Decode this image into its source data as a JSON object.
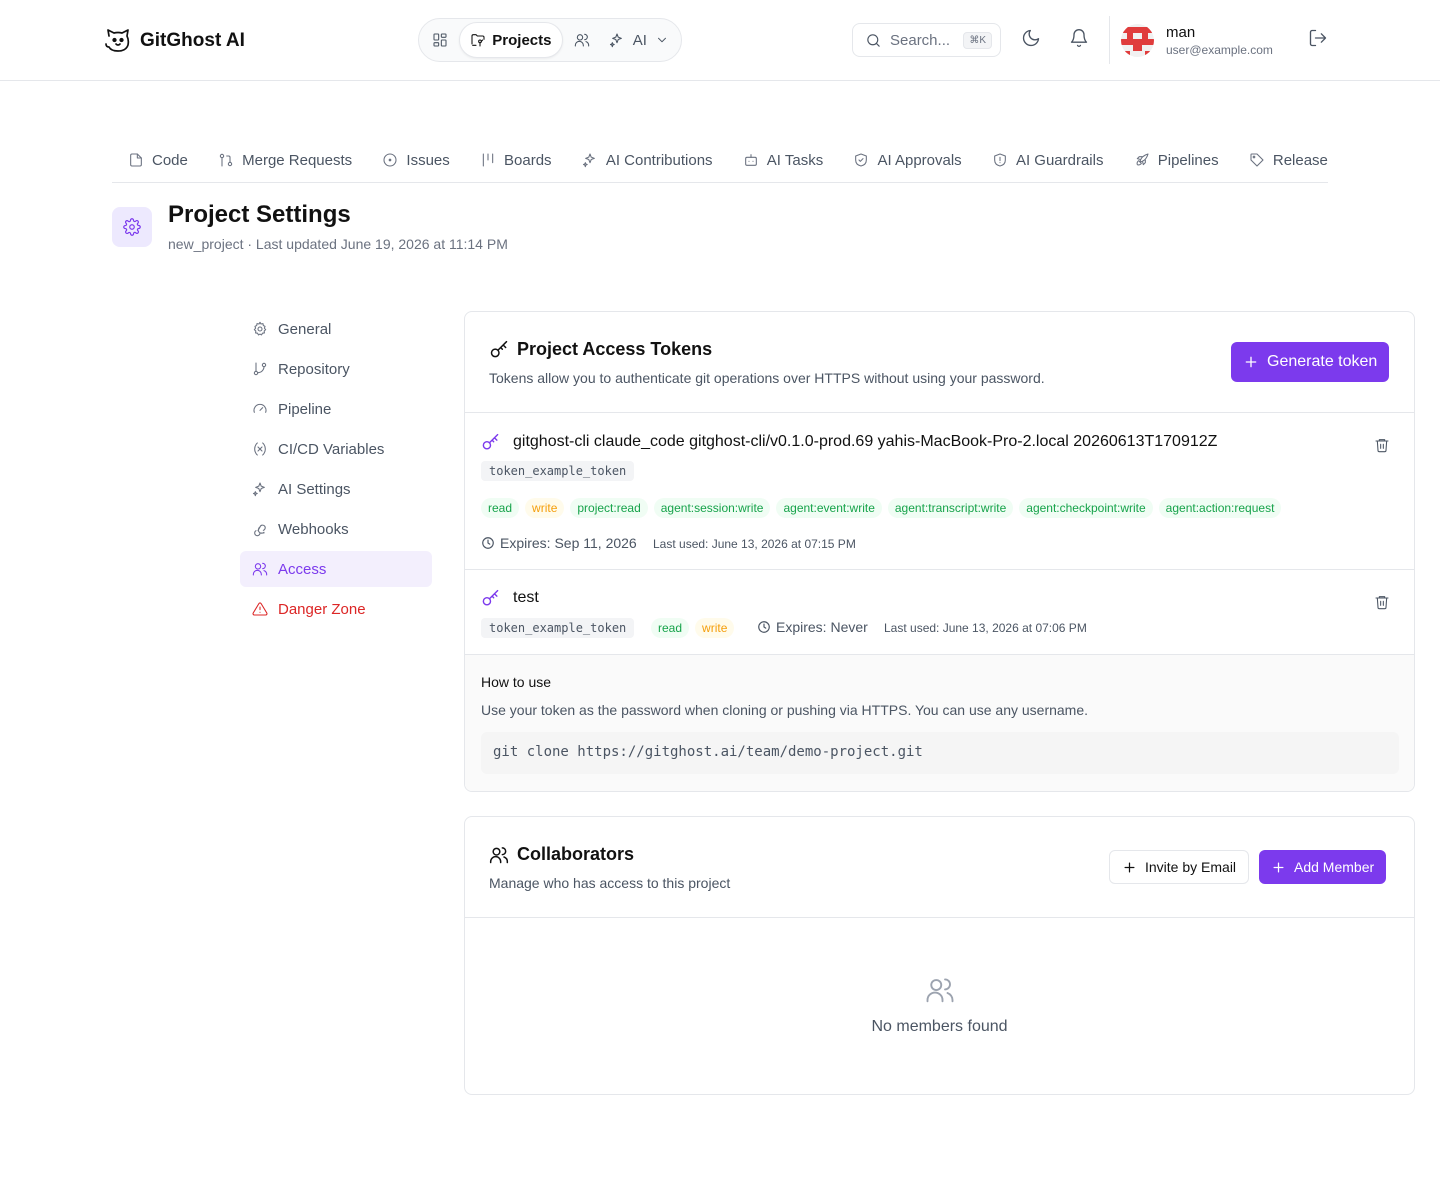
{
  "app": {
    "name": "GitGhost AI"
  },
  "topnav": {
    "projects_label": "Projects",
    "ai_label": "AI"
  },
  "search": {
    "placeholder": "Search...",
    "shortcut": "⌘K"
  },
  "user": {
    "name": "man",
    "email": "user@example.com"
  },
  "project_tabs": [
    {
      "label": "Code",
      "icon": "file-icon"
    },
    {
      "label": "Merge Requests",
      "icon": "git-pull-request-icon"
    },
    {
      "label": "Issues",
      "icon": "circle-dot-icon"
    },
    {
      "label": "Boards",
      "icon": "kanban-icon"
    },
    {
      "label": "AI Contributions",
      "icon": "sparkles-icon"
    },
    {
      "label": "AI Tasks",
      "icon": "bot-icon"
    },
    {
      "label": "AI Approvals",
      "icon": "shield-check-icon"
    },
    {
      "label": "AI Guardrails",
      "icon": "shield-alert-icon"
    },
    {
      "label": "Pipelines",
      "icon": "rocket-icon"
    },
    {
      "label": "Release",
      "icon": "tag-icon"
    }
  ],
  "page": {
    "title": "Project Settings",
    "subtitle": "new_project · Last updated June 19, 2026 at 11:14 PM"
  },
  "settings_menu": [
    {
      "label": "General",
      "icon": "gear-icon"
    },
    {
      "label": "Repository",
      "icon": "git-branch-icon"
    },
    {
      "label": "Pipeline",
      "icon": "gauge-icon"
    },
    {
      "label": "CI/CD Variables",
      "icon": "variable-icon"
    },
    {
      "label": "AI Settings",
      "icon": "sparkles-icon"
    },
    {
      "label": "Webhooks",
      "icon": "webhook-icon"
    },
    {
      "label": "Access",
      "icon": "users-icon",
      "active": true
    },
    {
      "label": "Danger Zone",
      "icon": "warning-icon",
      "danger": true
    }
  ],
  "tokens_card": {
    "title": "Project Access Tokens",
    "description": "Tokens allow you to authenticate git operations over HTTPS without using your password.",
    "generate_label": "Generate token",
    "tokens": [
      {
        "name": "gitghost-cli claude_code gitghost-cli/v0.1.0-prod.69 yahis-MacBook-Pro-2.local 20260613T170912Z",
        "token": "token_example_token",
        "scopes": [
          "read",
          "write",
          "project:read",
          "agent:session:write",
          "agent:event:write",
          "agent:transcript:write",
          "agent:checkpoint:write",
          "agent:action:request"
        ],
        "expires": "Expires: Sep 11, 2026",
        "last_used": "Last used: June 13, 2026 at 07:15 PM"
      },
      {
        "name": "test",
        "token": "token_example_token",
        "scopes": [
          "read",
          "write"
        ],
        "expires": "Expires: Never",
        "last_used": "Last used: June 13, 2026 at 07:06 PM"
      }
    ],
    "howto": {
      "title": "How to use",
      "description": "Use your token as the password when cloning or pushing via HTTPS. You can use any username.",
      "command": "git clone https://gitghost.ai/team/demo-project.git"
    }
  },
  "collab_card": {
    "title": "Collaborators",
    "description": "Manage who has access to this project",
    "invite_label": "Invite by Email",
    "add_label": "Add Member",
    "empty_text": "No members found"
  },
  "colors": {
    "accent": "#7c3aed",
    "danger": "#dc2626",
    "scope_green": "#16a34a",
    "scope_amber": "#f59e0b"
  }
}
